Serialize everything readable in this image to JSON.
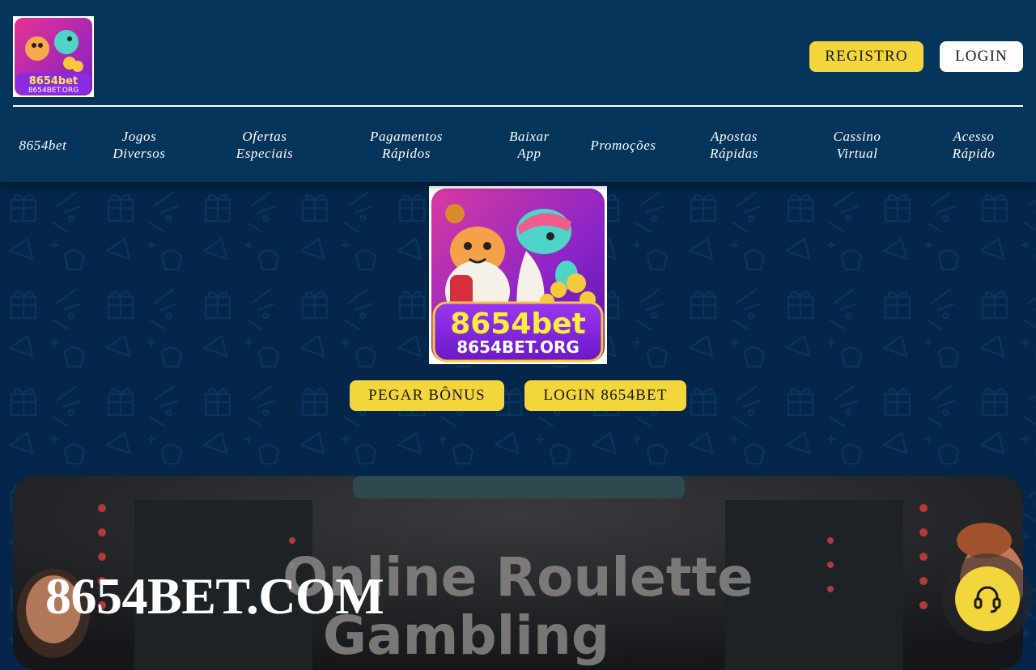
{
  "header": {
    "logo_alt": "8654bet logo",
    "logo_text_main": "8654bet",
    "logo_text_sub": "8654BET.ORG",
    "register_label": "REGISTRO",
    "login_label": "LOGIN"
  },
  "nav": {
    "items": [
      {
        "label": "8654bet"
      },
      {
        "label": "Jogos\nDiversos"
      },
      {
        "label": "Ofertas\nEspeciais"
      },
      {
        "label": "Pagamentos\nRápidos"
      },
      {
        "label": "Baixar\nApp"
      },
      {
        "label": "Promoções"
      },
      {
        "label": "Apostas\nRápidas"
      },
      {
        "label": "Cassino\nVirtual"
      },
      {
        "label": "Acesso\nRápido"
      }
    ]
  },
  "hero": {
    "logo_text_main": "8654bet",
    "logo_text_sub": "8654BET.ORG",
    "bonus_label": "PEGAR BÔNUS",
    "login_label": "LOGIN 8654BET"
  },
  "banner": {
    "title": "8654BET.COM",
    "image_text_1": "Online Roulette",
    "image_text_2": "Gambling"
  },
  "support": {
    "icon": "headset-icon"
  },
  "colors": {
    "header_bg": "#05355a",
    "page_bg": "#03264a",
    "accent_yellow": "#f3d53c",
    "white": "#ffffff"
  }
}
